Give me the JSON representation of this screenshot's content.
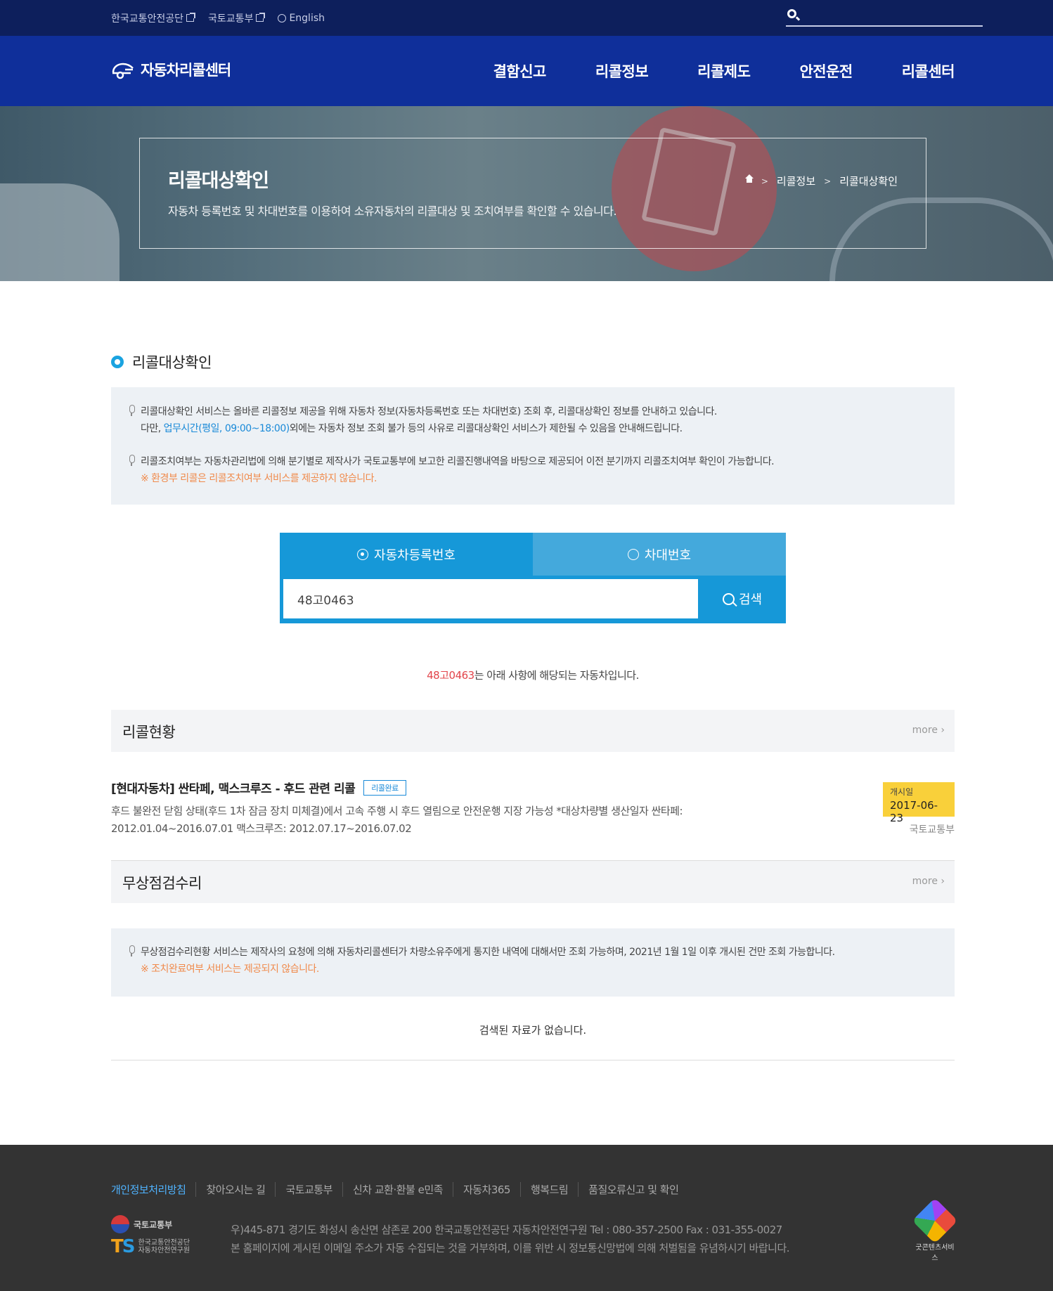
{
  "topbar": {
    "links": [
      "한국교통안전공단",
      "국토교통부",
      "English"
    ]
  },
  "header": {
    "logo_text": "자동차리콜센터",
    "nav": [
      "결함신고",
      "리콜정보",
      "리콜제도",
      "안전운전",
      "리콜센터"
    ]
  },
  "hero": {
    "title": "리콜대상확인",
    "description": "자동차 등록번호 및 차대번호를 이용하여 소유자동차의 리콜대상 및 조치여부를 확인할 수 있습니다.",
    "breadcrumb": [
      "리콜정보",
      "리콜대상확인"
    ]
  },
  "section": {
    "title": "리콜대상확인"
  },
  "info1": {
    "line1": "리콜대상확인 서비스는 올바른 리콜정보 제공을 위해 자동차 정보(자동차등록번호 또는 차대번호) 조회 후, 리콜대상확인 정보를 안내하고 있습니다.",
    "line2_pre": "다만, ",
    "line2_hl": "업무시간(평일, 09:00~18:00)",
    "line2_post": "외에는 자동차 정보 조회 불가 등의 사유로 리콜대상확인 서비스가 제한될 수 있음을 안내해드립니다.",
    "line3": "리콜조치여부는 자동차관리법에 의해 분기별로 제작사가 국토교통부에 보고한 리콜진행내역을 바탕으로 제공되어 이전 분기까지 리콜조치여부 확인이 가능합니다.",
    "line4": "※ 환경부 리콜은 리콜조치여부 서비스를 제공하지 않습니다."
  },
  "search": {
    "tab1": "자동차등록번호",
    "tab2": "차대번호",
    "value": "48고0463",
    "button": "검색"
  },
  "result": {
    "plate": "48고0463",
    "message": "는 아래 사항에 해당되는 자동차입니다."
  },
  "recall_status": {
    "title": "리콜현황",
    "more": "more",
    "item": {
      "title": "[현대자동차] 싼타페, 맥스크루즈 - 후드 관련 리콜",
      "badge": "리콜완료",
      "desc": "후드 불완전 닫힘 상태(후드 1차 잠금 장치 미체결)에서 고속 주행 시 후드 열림으로 안전운행 지장 가능성 *대상차량별 생산일자 싼타페: 2012.01.04~2016.07.01 맥스크루즈: 2012.07.17~2016.07.02",
      "date_label": "개시일",
      "date": "2017-06-23",
      "org": "국토교통부"
    }
  },
  "free_repair": {
    "title": "무상점검수리",
    "more": "more",
    "info1": "무상점검수리현황 서비스는 제작사의 요청에 의해 자동차리콜센터가 차량소유주에게 통지한 내역에 대해서만 조회 가능하며, 2021년 1월 1일 이후 개시된 건만 조회 가능합니다.",
    "info2": "※ 조치완료여부 서비스는 제공되지 않습니다.",
    "nodata": "검색된 자료가 없습니다."
  },
  "footer": {
    "links": [
      "개인정보처리방침",
      "찾아오시는 길",
      "국토교통부",
      "신차 교환·환불 e민족",
      "자동차365",
      "행복드림",
      "품질오류신고 및 확인"
    ],
    "moct": "국토교통부",
    "ts_line1": "한국교통안전공단",
    "ts_line2": "자동차안전연구원",
    "address": "우)445-871 경기도 화성시 송산면 삼존로 200 한국교통안전공단 자동차안전연구원 Tel : 080-357-2500 Fax : 031-355-0027",
    "notice": "본 홈페이지에 게시된 이메일 주소가 자동 수집되는 것을 거부하며, 이를 위반 시 정보통신망법에 의해 처벌됨을 유념하시기 바랍니다.",
    "gcs": "굿콘텐츠서비스"
  }
}
